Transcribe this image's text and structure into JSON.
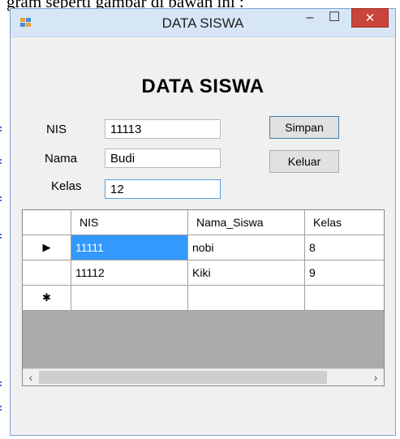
{
  "doc": {
    "text": "gram seperti gambar di bawah ini :"
  },
  "window": {
    "title": "DATA SISWA",
    "controls": {
      "minimize": "–",
      "maximize": "☐",
      "close": "✕"
    }
  },
  "form": {
    "heading": "DATA SISWA",
    "fields": {
      "nis": {
        "label": "NIS",
        "value": "11113"
      },
      "nama": {
        "label": "Nama",
        "value": "Budi"
      },
      "kelas": {
        "label": "Kelas",
        "value": "12"
      }
    },
    "buttons": {
      "save": "Simpan",
      "exit": "Keluar"
    }
  },
  "grid": {
    "columns": [
      "NIS",
      "Nama_Siswa",
      "Kelas"
    ],
    "rows": [
      {
        "marker": "▶",
        "nis": "11111",
        "nama": "nobi",
        "kelas": "8",
        "selected_cell": "nis"
      },
      {
        "marker": "",
        "nis": "11112",
        "nama": "Kiki",
        "kelas": "9"
      }
    ],
    "new_row_marker": "✱",
    "scroll": {
      "left": "‹",
      "right": "›"
    }
  },
  "colors": {
    "selection": "#3399ff",
    "close_button": "#c7453a",
    "titlebar": "#d6e6f7"
  },
  "icons": [
    "app-icon",
    "minimize-icon",
    "maximize-icon",
    "close-icon",
    "current-row-arrow-icon",
    "new-row-asterisk-icon",
    "scroll-left-icon",
    "scroll-right-icon"
  ]
}
